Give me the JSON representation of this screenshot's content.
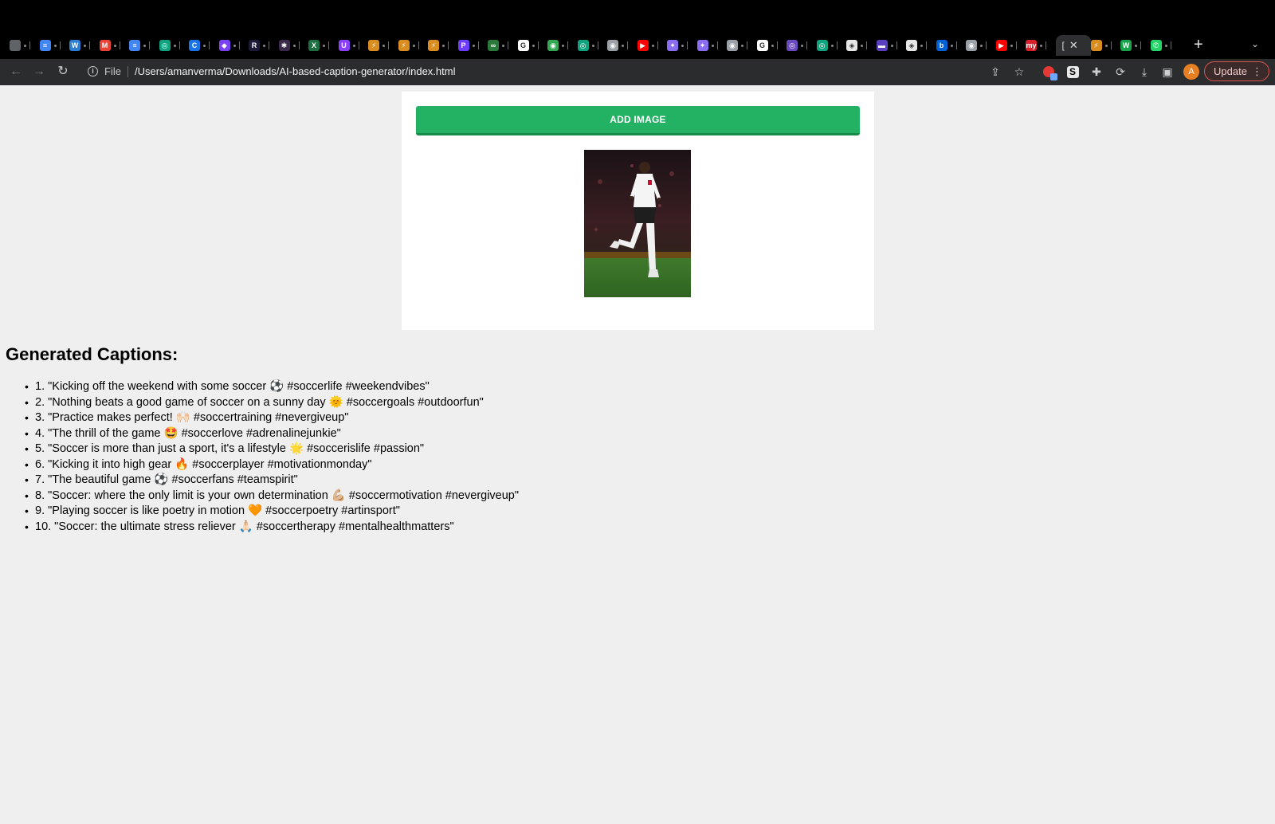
{
  "browser": {
    "tabs": [
      {
        "icon": "chrome-icon",
        "color": "#5f6368",
        "glyph": ""
      },
      {
        "icon": "docs-icon",
        "color": "#4285f4",
        "glyph": "≡"
      },
      {
        "icon": "word-icon",
        "color": "#2b7cd3",
        "glyph": "W"
      },
      {
        "icon": "gmail-icon",
        "color": "#ea4335",
        "glyph": "M"
      },
      {
        "icon": "docs-icon",
        "color": "#4285f4",
        "glyph": "≡"
      },
      {
        "icon": "chatgpt-icon",
        "color": "#10a37f",
        "glyph": "◎"
      },
      {
        "icon": "c-icon",
        "color": "#1a73e8",
        "glyph": "C"
      },
      {
        "icon": "shield-icon",
        "color": "#7b42f5",
        "glyph": "◆"
      },
      {
        "icon": "r-icon",
        "color": "#1c1c3a",
        "glyph": "R"
      },
      {
        "icon": "slack-icon",
        "color": "#3b2a4a",
        "glyph": "✱"
      },
      {
        "icon": "excel-icon",
        "color": "#1d6f42",
        "glyph": "X"
      },
      {
        "icon": "u-icon",
        "color": "#8a3ffc",
        "glyph": "U"
      },
      {
        "icon": "bolt-icon",
        "color": "#d98c1f",
        "glyph": "⚡"
      },
      {
        "icon": "bolt-icon",
        "color": "#d98c1f",
        "glyph": "⚡"
      },
      {
        "icon": "bolt-icon",
        "color": "#d98c1f",
        "glyph": "⚡"
      },
      {
        "icon": "p-icon",
        "color": "#6c3cff",
        "glyph": "P"
      },
      {
        "icon": "infinity-icon",
        "color": "#2a7a3a",
        "glyph": "∞"
      },
      {
        "icon": "google-icon",
        "color": "#ffffff",
        "glyph": "G"
      },
      {
        "icon": "maps-icon",
        "color": "#34a853",
        "glyph": "◉"
      },
      {
        "icon": "chatgpt-icon",
        "color": "#10a37f",
        "glyph": "◎"
      },
      {
        "icon": "chrome-icon",
        "color": "#9aa0a6",
        "glyph": "◉"
      },
      {
        "icon": "youtube-icon",
        "color": "#ff0000",
        "glyph": "▶"
      },
      {
        "icon": "gemini-icon",
        "color": "#8a6cf0",
        "glyph": "✦"
      },
      {
        "icon": "gemini-icon",
        "color": "#8a6cf0",
        "glyph": "✦"
      },
      {
        "icon": "chrome-icon",
        "color": "#9aa0a6",
        "glyph": "◉"
      },
      {
        "icon": "google-icon",
        "color": "#ffffff",
        "glyph": "G"
      },
      {
        "icon": "circle-icon",
        "color": "#6a4bbf",
        "glyph": "◎"
      },
      {
        "icon": "chatgpt-icon",
        "color": "#10a37f",
        "glyph": "◎"
      },
      {
        "icon": "codepen-icon",
        "color": "#e6e6e6",
        "glyph": "◈"
      },
      {
        "icon": "purple-app-icon",
        "color": "#5a3fc0",
        "glyph": "▬"
      },
      {
        "icon": "codepen-icon",
        "color": "#e6e6e6",
        "glyph": "◈"
      },
      {
        "icon": "box-icon",
        "color": "#0061d5",
        "glyph": "b"
      },
      {
        "icon": "chrome-icon",
        "color": "#9aa0a6",
        "glyph": "◉"
      },
      {
        "icon": "youtube-icon",
        "color": "#ff0000",
        "glyph": "▶"
      },
      {
        "icon": "my-icon",
        "color": "#d6202a",
        "glyph": "my"
      }
    ],
    "active_tab": {
      "glyph": "[",
      "close": "✕"
    },
    "after_tabs": [
      {
        "icon": "flame-app-icon",
        "color": "#d98c1f",
        "glyph": "⚡"
      },
      {
        "icon": "w-icon",
        "color": "#16a34a",
        "glyph": "W"
      },
      {
        "icon": "whatsapp-icon",
        "color": "#25d366",
        "glyph": "✆"
      }
    ],
    "new_tab": "+",
    "tab_list": "⌄",
    "scheme_label": "File",
    "url": "/Users/amanverma/Downloads/AI-based-caption-generator/index.html",
    "update_label": "Update",
    "avatar_letter": "A"
  },
  "page": {
    "add_image_label": "ADD IMAGE",
    "captions_title": "Generated Captions:",
    "captions": [
      "1. \"Kicking off the weekend with some soccer ⚽ #soccerlife #weekendvibes\"",
      "2. \"Nothing beats a good game of soccer on a sunny day 🌞 #soccergoals #outdoorfun\"",
      "3. \"Practice makes perfect! 🙌🏻 #soccertraining #nevergiveup\"",
      "4. \"The thrill of the game 🤩 #soccerlove #adrenalinejunkie\"",
      "5. \"Soccer is more than just a sport, it's a lifestyle 🌟 #soccerislife #passion\"",
      "6. \"Kicking it into high gear 🔥 #soccerplayer #motivationmonday\"",
      "7. \"The beautiful game ⚽ #soccerfans #teamspirit\"",
      "8. \"Soccer: where the only limit is your own determination 💪🏼 #soccermotivation #nevergiveup\"",
      "9. \"Playing soccer is like poetry in motion 🧡 #soccerpoetry #artinsport\"",
      "10. \"Soccer: the ultimate stress reliever 🙏🏻 #soccertherapy #mentalhealthmatters\""
    ]
  }
}
